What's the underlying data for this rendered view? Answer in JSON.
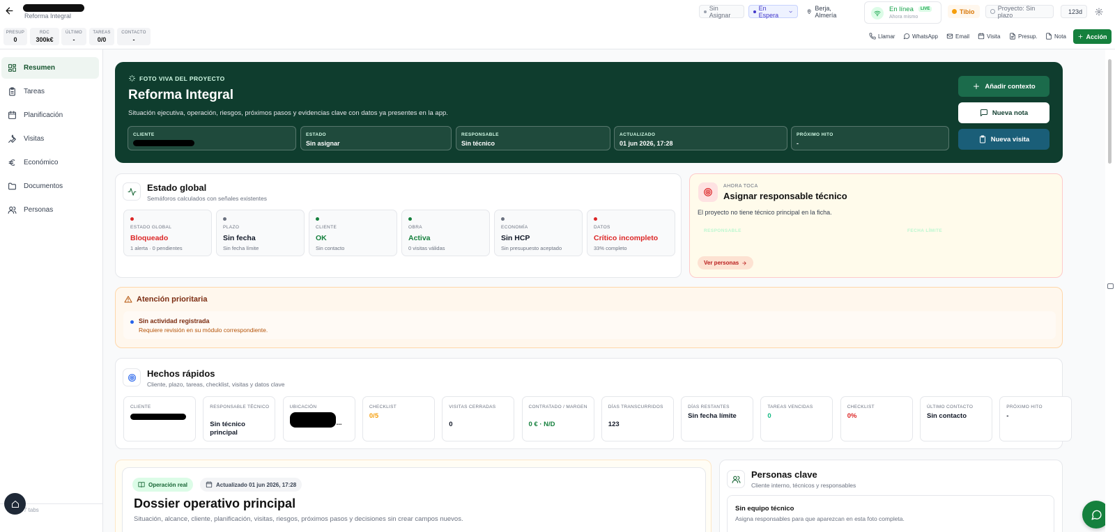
{
  "header": {
    "project_subtitle": "Reforma Integral",
    "metrics": [
      {
        "label": "PRESUP",
        "value": "0"
      },
      {
        "label": "RDC",
        "value": "300k€"
      },
      {
        "label": "ÚLTIMO",
        "value": "-"
      },
      {
        "label": "TAREAS",
        "value": "0/0"
      },
      {
        "label": "CONTACTO",
        "value": "-"
      }
    ],
    "assign_pill": "Sin Asignar",
    "status_pill": "En Espera",
    "location": "Berja, Almería",
    "online_label": "En línea",
    "live_badge": "LIVE",
    "online_sub": "Ahora mismo",
    "temperature": "Tibio",
    "deadline_pill": "Proyecto: Sin plazo",
    "days": "123d",
    "actions": [
      "Llamar",
      "WhatsApp",
      "Email",
      "Visita",
      "Presup.",
      "Nota"
    ],
    "main_action": "Acción"
  },
  "sidebar": {
    "items": [
      {
        "label": "Resumen",
        "icon": "dashboard-icon"
      },
      {
        "label": "Tareas",
        "icon": "clipboard-icon"
      },
      {
        "label": "Planificación",
        "icon": "calendar-icon"
      },
      {
        "label": "Visitas",
        "icon": "wrench-icon"
      },
      {
        "label": "Económico",
        "icon": "euro-icon"
      },
      {
        "label": "Documentos",
        "icon": "folder-icon"
      },
      {
        "label": "Personas",
        "icon": "users-icon"
      }
    ],
    "footer_text": "7 tabs"
  },
  "hero": {
    "kicker": "FOTO VIVA DEL PROYECTO",
    "title": "Reforma Integral",
    "description": "Situación ejecutiva, operación, riesgos, próximos pasos y evidencias clave con datos ya presentes en la app.",
    "fields": [
      {
        "label": "CLIENTE",
        "value": ""
      },
      {
        "label": "ESTADO",
        "value": "Sin asignar"
      },
      {
        "label": "RESPONSABLE",
        "value": "Sin técnico"
      },
      {
        "label": "ACTUALIZADO",
        "value": "01 jun 2026, 17:28"
      },
      {
        "label": "PRÓXIMO HITO",
        "value": "-"
      }
    ],
    "btn_context": "Añadir contexto",
    "btn_note": "Nueva nota",
    "btn_visit": "Nueva visita"
  },
  "estado_global": {
    "title": "Estado global",
    "subtitle": "Semáforos calculados con señales existentes",
    "tiles": [
      {
        "label": "ESTADO GLOBAL",
        "value": "Bloqueado",
        "sub": "1 alerta · 0 pendientes",
        "color": "#dc2626",
        "dot": "#dc2626"
      },
      {
        "label": "PLAZO",
        "value": "Sin fecha",
        "sub": "Sin fecha límite",
        "color": "#111827",
        "dot": "#6b7280"
      },
      {
        "label": "CLIENTE",
        "value": "OK",
        "sub": "Sin contacto",
        "color": "#15803d",
        "dot": "#15803d"
      },
      {
        "label": "OBRA",
        "value": "Activa",
        "sub": "0 visitas válidas",
        "color": "#15803d",
        "dot": "#15803d"
      },
      {
        "label": "ECONOMÍA",
        "value": "Sin HCP",
        "sub": "Sin presupuesto aceptado",
        "color": "#111827",
        "dot": "#6b7280"
      },
      {
        "label": "DATOS",
        "value": "Crítico incompleto",
        "sub": "33% completo",
        "color": "#dc2626",
        "dot": "#dc2626"
      }
    ]
  },
  "ahora_toca": {
    "kicker": "AHORA TOCA",
    "title": "Asignar responsable técnico",
    "text": "El proyecto no tiene técnico principal en la ficha.",
    "faded_1": "RESPONSABLE",
    "faded_2": "FECHA LÍMITE",
    "button": "Ver personas"
  },
  "atencion": {
    "title": "Atención prioritaria",
    "item_title": "Sin actividad registrada",
    "item_text": "Requiere revisión en su módulo correspondiente."
  },
  "hechos": {
    "title": "Hechos rápidos",
    "subtitle": "Cliente, plazo, tareas, checklist, visitas y datos clave",
    "facts": [
      {
        "label": "CLIENTE",
        "value": "",
        "color": "#111827"
      },
      {
        "label": "RESPONSABLE TÉCNICO",
        "value": "Sin técnico principal",
        "color": "#111827"
      },
      {
        "label": "UBICACIÓN",
        "value": "...",
        "color": "#111827"
      },
      {
        "label": "CHECKLIST",
        "value": "0/5",
        "color": "#f59e0b"
      },
      {
        "label": "VISITAS CERRADAS",
        "value": "0",
        "color": "#111827"
      },
      {
        "label": "CONTRATADO / MARGEN",
        "value": "0 € · N/D",
        "color": "#15803d"
      },
      {
        "label": "DÍAS TRANSCURRIDOS",
        "value": "123",
        "color": "#111827"
      },
      {
        "label": "DÍAS RESTANTES",
        "value": "Sin fecha límite",
        "color": "#111827"
      },
      {
        "label": "TAREAS VENCIDAS",
        "value": "0",
        "color": "#10b981"
      },
      {
        "label": "CHECKLIST",
        "value": "0%",
        "color": "#dc2626"
      },
      {
        "label": "ÚLTIMO CONTACTO",
        "value": "Sin contacto",
        "color": "#111827"
      },
      {
        "label": "PRÓXIMO HITO",
        "value": "-",
        "color": "#111827"
      }
    ]
  },
  "dossier": {
    "tag": "Operación real",
    "updated": "Actualizado 01 jun 2026, 17:28",
    "title": "Dossier operativo principal",
    "text": "Situación, alcance, cliente, planificación, visitas, riesgos, próximos pasos y decisiones sin crear campos nuevos."
  },
  "personas": {
    "title": "Personas clave",
    "subtitle": "Cliente interno, técnicos y responsables",
    "empty_title": "Sin equipo técnico",
    "empty_text": "Asigna responsables para que aparezcan en esta foto completa."
  }
}
